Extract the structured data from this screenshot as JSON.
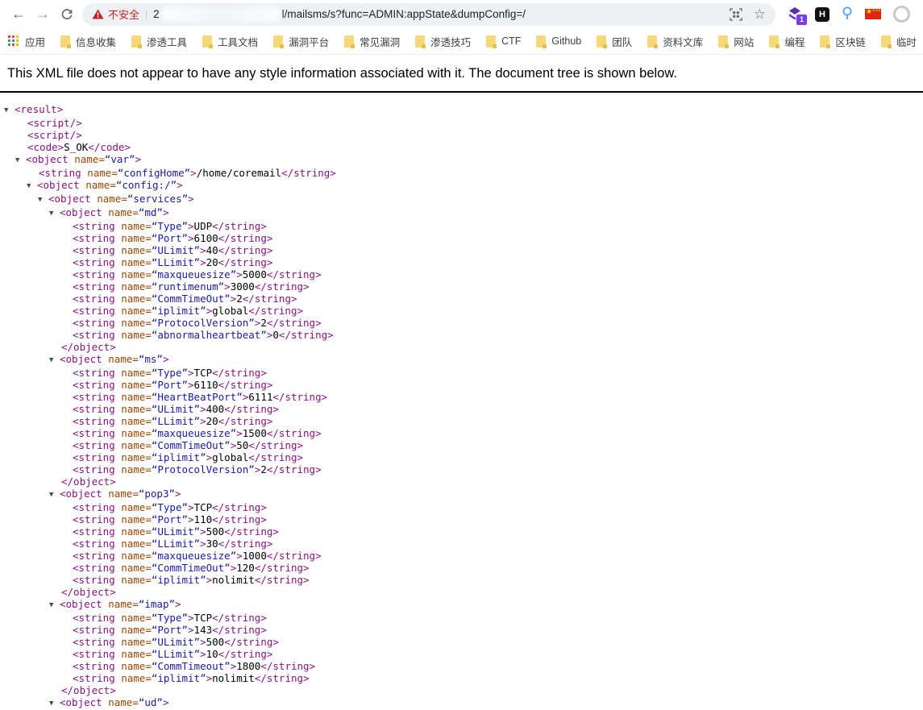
{
  "browser": {
    "toolbar": {
      "back_icon": "back-arrow",
      "forward_icon": "forward-arrow",
      "reload_icon": "reload",
      "address": {
        "security_warning": "不安全",
        "separator": "|",
        "url_visible_prefix": "2",
        "url": "l/mailsms/s?func=ADMIN:appState&dumpConfig=/",
        "redacted_host": true,
        "qr_icon": "qr-code-frame",
        "star_icon": "bookmark-star"
      },
      "extensions": [
        {
          "icon": "purple-layers",
          "badge": "1"
        },
        {
          "icon": "hackbar",
          "letter": "H"
        },
        {
          "icon": "blue-pin",
          "badge": ""
        },
        {
          "icon": "china-flag",
          "big_star": "★",
          "small_stars": "★★★★"
        },
        {
          "icon": "profile-ring",
          "badge": ""
        }
      ]
    },
    "bookmarks": {
      "apps_label": "应用",
      "items": [
        "信息收集",
        "渗透工具",
        "工具文档",
        "漏洞平台",
        "常见漏洞",
        "渗透技巧",
        "CTF",
        "Github",
        "团队",
        "资料文库",
        "网站",
        "编程",
        "区块链",
        "临时"
      ]
    }
  },
  "xml_viewer": {
    "header_message": "This XML file does not appear to have any style information associated with it. The document tree is shown below.",
    "colors": {
      "tag": "#881280",
      "attr_name": "#994500",
      "attr_value": "#1a1aa6",
      "text": "#000000",
      "warning_red": "#c5221f"
    },
    "tree": [
      {
        "i": 0,
        "a": true,
        "k": "open",
        "n": "result"
      },
      {
        "i": 1,
        "k": "self",
        "n": "script"
      },
      {
        "i": 1,
        "k": "self",
        "n": "script"
      },
      {
        "i": 1,
        "k": "pair",
        "n": "code",
        "tx": "S_OK"
      },
      {
        "i": 1,
        "a": true,
        "k": "open",
        "n": "object",
        "at": "name",
        "av": "var"
      },
      {
        "i": 2,
        "k": "pair",
        "n": "string",
        "at": "name",
        "av": "configHome",
        "tx": "/home/coremail"
      },
      {
        "i": 2,
        "a": true,
        "k": "open",
        "n": "object",
        "at": "name",
        "av": "config:/"
      },
      {
        "i": 3,
        "a": true,
        "k": "open",
        "n": "object",
        "at": "name",
        "av": "services"
      },
      {
        "i": 4,
        "a": true,
        "k": "open",
        "n": "object",
        "at": "name",
        "av": "md"
      },
      {
        "i": 5,
        "k": "pair",
        "n": "string",
        "at": "name",
        "av": "Type",
        "tx": "UDP"
      },
      {
        "i": 5,
        "k": "pair",
        "n": "string",
        "at": "name",
        "av": "Port",
        "tx": "6100"
      },
      {
        "i": 5,
        "k": "pair",
        "n": "string",
        "at": "name",
        "av": "ULimit",
        "tx": "40"
      },
      {
        "i": 5,
        "k": "pair",
        "n": "string",
        "at": "name",
        "av": "LLimit",
        "tx": "20"
      },
      {
        "i": 5,
        "k": "pair",
        "n": "string",
        "at": "name",
        "av": "maxqueuesize",
        "tx": "5000"
      },
      {
        "i": 5,
        "k": "pair",
        "n": "string",
        "at": "name",
        "av": "runtimenum",
        "tx": "3000"
      },
      {
        "i": 5,
        "k": "pair",
        "n": "string",
        "at": "name",
        "av": "CommTimeOut",
        "tx": "2"
      },
      {
        "i": 5,
        "k": "pair",
        "n": "string",
        "at": "name",
        "av": "iplimit",
        "tx": "global"
      },
      {
        "i": 5,
        "k": "pair",
        "n": "string",
        "at": "name",
        "av": "ProtocolVersion",
        "tx": "2"
      },
      {
        "i": 5,
        "k": "pair",
        "n": "string",
        "at": "name",
        "av": "abnormalheartbeat",
        "tx": "0"
      },
      {
        "i": 4,
        "k": "close",
        "n": "object"
      },
      {
        "i": 4,
        "a": true,
        "k": "open",
        "n": "object",
        "at": "name",
        "av": "ms"
      },
      {
        "i": 5,
        "k": "pair",
        "n": "string",
        "at": "name",
        "av": "Type",
        "tx": "TCP"
      },
      {
        "i": 5,
        "k": "pair",
        "n": "string",
        "at": "name",
        "av": "Port",
        "tx": "6110"
      },
      {
        "i": 5,
        "k": "pair",
        "n": "string",
        "at": "name",
        "av": "HeartBeatPort",
        "tx": "6111"
      },
      {
        "i": 5,
        "k": "pair",
        "n": "string",
        "at": "name",
        "av": "ULimit",
        "tx": "400"
      },
      {
        "i": 5,
        "k": "pair",
        "n": "string",
        "at": "name",
        "av": "LLimit",
        "tx": "20"
      },
      {
        "i": 5,
        "k": "pair",
        "n": "string",
        "at": "name",
        "av": "maxqueuesize",
        "tx": "1500"
      },
      {
        "i": 5,
        "k": "pair",
        "n": "string",
        "at": "name",
        "av": "CommTimeOut",
        "tx": "50"
      },
      {
        "i": 5,
        "k": "pair",
        "n": "string",
        "at": "name",
        "av": "iplimit",
        "tx": "global"
      },
      {
        "i": 5,
        "k": "pair",
        "n": "string",
        "at": "name",
        "av": "ProtocolVersion",
        "tx": "2"
      },
      {
        "i": 4,
        "k": "close",
        "n": "object"
      },
      {
        "i": 4,
        "a": true,
        "k": "open",
        "n": "object",
        "at": "name",
        "av": "pop3"
      },
      {
        "i": 5,
        "k": "pair",
        "n": "string",
        "at": "name",
        "av": "Type",
        "tx": "TCP"
      },
      {
        "i": 5,
        "k": "pair",
        "n": "string",
        "at": "name",
        "av": "Port",
        "tx": "110"
      },
      {
        "i": 5,
        "k": "pair",
        "n": "string",
        "at": "name",
        "av": "ULimit",
        "tx": "500"
      },
      {
        "i": 5,
        "k": "pair",
        "n": "string",
        "at": "name",
        "av": "LLimit",
        "tx": "30"
      },
      {
        "i": 5,
        "k": "pair",
        "n": "string",
        "at": "name",
        "av": "maxqueuesize",
        "tx": "1000"
      },
      {
        "i": 5,
        "k": "pair",
        "n": "string",
        "at": "name",
        "av": "CommTimeOut",
        "tx": "120"
      },
      {
        "i": 5,
        "k": "pair",
        "n": "string",
        "at": "name",
        "av": "iplimit",
        "tx": "nolimit"
      },
      {
        "i": 4,
        "k": "close",
        "n": "object"
      },
      {
        "i": 4,
        "a": true,
        "k": "open",
        "n": "object",
        "at": "name",
        "av": "imap"
      },
      {
        "i": 5,
        "k": "pair",
        "n": "string",
        "at": "name",
        "av": "Type",
        "tx": "TCP"
      },
      {
        "i": 5,
        "k": "pair",
        "n": "string",
        "at": "name",
        "av": "Port",
        "tx": "143"
      },
      {
        "i": 5,
        "k": "pair",
        "n": "string",
        "at": "name",
        "av": "ULimit",
        "tx": "500"
      },
      {
        "i": 5,
        "k": "pair",
        "n": "string",
        "at": "name",
        "av": "LLimit",
        "tx": "10"
      },
      {
        "i": 5,
        "k": "pair",
        "n": "string",
        "at": "name",
        "av": "CommTimeout",
        "tx": "1800"
      },
      {
        "i": 5,
        "k": "pair",
        "n": "string",
        "at": "name",
        "av": "iplimit",
        "tx": "nolimit"
      },
      {
        "i": 4,
        "k": "close",
        "n": "object"
      },
      {
        "i": 4,
        "a": true,
        "k": "open",
        "n": "object",
        "at": "name",
        "av": "ud"
      }
    ]
  }
}
